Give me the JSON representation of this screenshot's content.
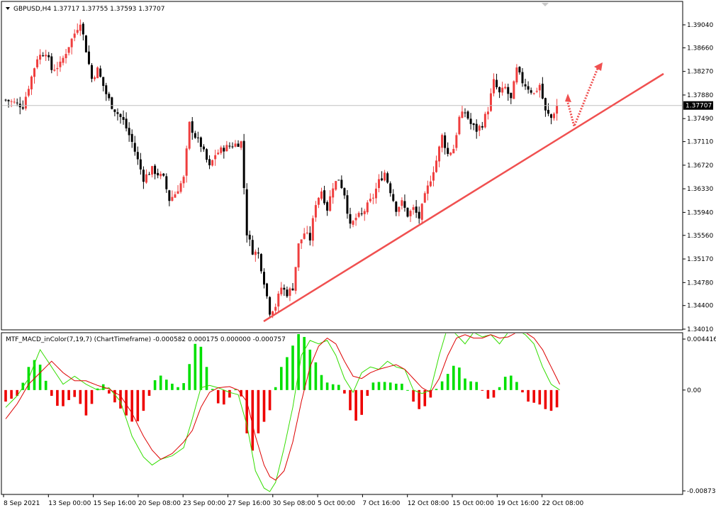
{
  "chart_data": [
    {
      "type": "candlestick",
      "title": "GBPUSD,H4  1.37717 1.37755 1.37593 1.37707",
      "current_price_label": "1.37707",
      "current_price": 1.37707,
      "ylim": [
        1.3401,
        1.3942
      ],
      "y_ticks": [
        "1.39040",
        "1.38660",
        "1.38270",
        "1.37880",
        "1.37490",
        "1.37110",
        "1.36720",
        "1.36330",
        "1.35940",
        "1.35560",
        "1.35170",
        "1.34780",
        "1.34400",
        "1.34010"
      ],
      "x_ticks": [
        "8 Sep 2021",
        "13 Sep 00:00",
        "15 Sep 16:00",
        "20 Sep 08:00",
        "23 Sep 00:00",
        "27 Sep 16:00",
        "30 Sep 08:00",
        "5 Oct 00:00",
        "7 Oct 16:00",
        "12 Oct 08:00",
        "15 Oct 00:00",
        "19 Oct 16:00",
        "22 Oct 08:00"
      ],
      "close_path": [
        [
          0,
          1.378
        ],
        [
          6,
          1.377
        ],
        [
          11,
          1.385
        ],
        [
          14,
          1.386
        ],
        [
          16,
          1.383
        ],
        [
          19,
          1.3838
        ],
        [
          22,
          1.387
        ],
        [
          26,
          1.391
        ],
        [
          30,
          1.3815
        ],
        [
          32,
          1.383
        ],
        [
          35,
          1.379
        ],
        [
          37,
          1.377
        ],
        [
          41,
          1.3745
        ],
        [
          44,
          1.371
        ],
        [
          48,
          1.365
        ],
        [
          51,
          1.3665
        ],
        [
          55,
          1.365
        ],
        [
          57,
          1.3615
        ],
        [
          59,
          1.3625
        ],
        [
          62,
          1.365
        ],
        [
          64,
          1.374
        ],
        [
          66,
          1.372
        ],
        [
          68,
          1.3705
        ],
        [
          71,
          1.3668
        ],
        [
          73,
          1.369
        ],
        [
          76,
          1.37
        ],
        [
          79,
          1.3705
        ],
        [
          82,
          1.371
        ],
        [
          84,
          1.356
        ],
        [
          86,
          1.353
        ],
        [
          88,
          1.3525
        ],
        [
          90,
          1.348
        ],
        [
          92,
          1.343
        ],
        [
          94,
          1.344
        ],
        [
          96,
          1.347
        ],
        [
          98,
          1.346
        ],
        [
          100,
          1.347
        ],
        [
          102,
          1.354
        ],
        [
          104,
          1.356
        ],
        [
          106,
          1.355
        ],
        [
          108,
          1.361
        ],
        [
          110,
          1.363
        ],
        [
          112,
          1.36
        ],
        [
          114,
          1.3638
        ],
        [
          116,
          1.365
        ],
        [
          118,
          1.3625
        ],
        [
          120,
          1.357
        ],
        [
          122,
          1.3585
        ],
        [
          124,
          1.359
        ],
        [
          126,
          1.3605
        ],
        [
          128,
          1.362
        ],
        [
          130,
          1.3645
        ],
        [
          132,
          1.366
        ],
        [
          134,
          1.363
        ],
        [
          136,
          1.36
        ],
        [
          138,
          1.361
        ],
        [
          140,
          1.359
        ],
        [
          142,
          1.36
        ],
        [
          144,
          1.3585
        ],
        [
          146,
          1.362
        ],
        [
          148,
          1.365
        ],
        [
          150,
          1.368
        ],
        [
          152,
          1.372
        ],
        [
          154,
          1.369
        ],
        [
          156,
          1.37
        ],
        [
          158,
          1.375
        ],
        [
          160,
          1.376
        ],
        [
          162,
          1.374
        ],
        [
          164,
          1.373
        ],
        [
          166,
          1.374
        ],
        [
          168,
          1.3765
        ],
        [
          170,
          1.381
        ],
        [
          172,
          1.379
        ],
        [
          174,
          1.38
        ],
        [
          176,
          1.378
        ],
        [
          178,
          1.383
        ],
        [
          180,
          1.381
        ],
        [
          182,
          1.38
        ],
        [
          184,
          1.379
        ],
        [
          186,
          1.3805
        ],
        [
          188,
          1.376
        ],
        [
          190,
          1.375
        ],
        [
          192,
          1.3771
        ]
      ],
      "annotations": [
        "rising-trendline",
        "projected-path-arrow"
      ]
    },
    {
      "type": "bar+line",
      "title": "MTF_MACD_inColor(7,19,7) (ChartTimeframe) -0.000582 0.000175 0.000000 -0.000757",
      "ylim": [
        -0.008737,
        0.004416
      ],
      "y_ticks": [
        "0.004416",
        "0.00",
        "-0.008737"
      ],
      "histogram_path": [
        [
          0,
          -0.001
        ],
        [
          4,
          -0.0005
        ],
        [
          7,
          0.0012
        ],
        [
          9,
          0.0028
        ],
        [
          12,
          0.0022
        ],
        [
          14,
          0.0008
        ],
        [
          16,
          -0.0005
        ],
        [
          19,
          -0.0018
        ],
        [
          21,
          -0.001
        ],
        [
          24,
          -0.0006
        ],
        [
          26,
          -0.0012
        ],
        [
          28,
          -0.0022
        ],
        [
          30,
          -0.0012
        ],
        [
          33,
          0.0008
        ],
        [
          35,
          0.0002
        ],
        [
          37,
          -0.0008
        ],
        [
          40,
          -0.0016
        ],
        [
          42,
          -0.0022
        ],
        [
          45,
          -0.003
        ],
        [
          47,
          -0.0024
        ],
        [
          49,
          -0.0012
        ],
        [
          51,
          0.0002
        ],
        [
          53,
          0.0015
        ],
        [
          55,
          0.001
        ],
        [
          57,
          0.0008
        ],
        [
          59,
          0.0003
        ],
        [
          61,
          0.0002
        ],
        [
          63,
          0.001
        ],
        [
          65,
          0.0035
        ],
        [
          67,
          0.0045
        ],
        [
          69,
          0.003
        ],
        [
          71,
          0.001
        ],
        [
          73,
          -0.0008
        ],
        [
          75,
          -0.0015
        ],
        [
          77,
          -0.001
        ],
        [
          79,
          -0.0003
        ],
        [
          81,
          0.0004
        ],
        [
          83,
          -0.0015
        ],
        [
          85,
          -0.006
        ],
        [
          87,
          -0.0045
        ],
        [
          89,
          -0.003
        ],
        [
          91,
          -0.0025
        ],
        [
          93,
          -0.001
        ],
        [
          95,
          0.0015
        ],
        [
          97,
          0.0025
        ],
        [
          99,
          0.0032
        ],
        [
          101,
          0.0045
        ],
        [
          103,
          0.0052
        ],
        [
          105,
          0.004
        ],
        [
          107,
          0.003
        ],
        [
          109,
          0.0018
        ],
        [
          111,
          0.0008
        ],
        [
          113,
          0.0005
        ],
        [
          115,
          0.0005
        ],
        [
          117,
          0.0004
        ],
        [
          119,
          -0.001
        ],
        [
          121,
          -0.0025
        ],
        [
          123,
          -0.0028
        ],
        [
          125,
          -0.0015
        ],
        [
          127,
          0.0005
        ],
        [
          129,
          0.0008
        ],
        [
          131,
          0.0006
        ],
        [
          133,
          0.0008
        ],
        [
          135,
          0.0005
        ],
        [
          137,
          0.0006
        ],
        [
          139,
          0.0005
        ],
        [
          141,
          -0.0005
        ],
        [
          143,
          -0.0015
        ],
        [
          145,
          -0.0018
        ],
        [
          147,
          -0.001
        ],
        [
          149,
          -0.0003
        ],
        [
          151,
          0.0005
        ],
        [
          153,
          0.001
        ],
        [
          155,
          0.0018
        ],
        [
          157,
          0.0024
        ],
        [
          159,
          0.0015
        ],
        [
          161,
          0.0005
        ],
        [
          163,
          0.001
        ],
        [
          165,
          0.0004
        ],
        [
          167,
          -0.0005
        ],
        [
          169,
          -0.001
        ],
        [
          171,
          -0.0003
        ],
        [
          173,
          0.0008
        ],
        [
          175,
          0.0015
        ],
        [
          177,
          0.001
        ],
        [
          179,
          0.0004
        ],
        [
          181,
          -0.0008
        ],
        [
          183,
          -0.0012
        ],
        [
          185,
          -0.001
        ],
        [
          187,
          -0.0015
        ],
        [
          189,
          -0.0018
        ],
        [
          191,
          -0.0018
        ],
        [
          193,
          -0.0012
        ]
      ],
      "green_line": [
        [
          0,
          -0.0015
        ],
        [
          4,
          -0.0005
        ],
        [
          8,
          0.001
        ],
        [
          12,
          0.0035
        ],
        [
          16,
          0.002
        ],
        [
          20,
          0.0005
        ],
        [
          24,
          0.0012
        ],
        [
          28,
          0.0005
        ],
        [
          32,
          0.0
        ],
        [
          36,
          0.0002
        ],
        [
          40,
          -0.001
        ],
        [
          44,
          -0.004
        ],
        [
          48,
          -0.0058
        ],
        [
          51,
          -0.0065
        ],
        [
          54,
          -0.006
        ],
        [
          58,
          -0.0057
        ],
        [
          62,
          -0.005
        ],
        [
          65,
          -0.0025
        ],
        [
          68,
          0.0002
        ],
        [
          71,
          0.0004
        ],
        [
          74,
          0.0002
        ],
        [
          78,
          -0.0002
        ],
        [
          81,
          -0.0004
        ],
        [
          84,
          -0.003
        ],
        [
          87,
          -0.007
        ],
        [
          90,
          -0.0085
        ],
        [
          92,
          -0.0088
        ],
        [
          94,
          -0.008
        ],
        [
          97,
          -0.005
        ],
        [
          100,
          -0.0015
        ],
        [
          103,
          0.003
        ],
        [
          106,
          0.0043
        ],
        [
          109,
          0.004
        ],
        [
          112,
          0.0043
        ],
        [
          115,
          0.003
        ],
        [
          118,
          0.001
        ],
        [
          121,
          -0.0002
        ],
        [
          124,
          0.0015
        ],
        [
          127,
          0.002
        ],
        [
          130,
          0.0018
        ],
        [
          133,
          0.0025
        ],
        [
          136,
          0.002
        ],
        [
          139,
          0.0018
        ],
        [
          142,
          0.0
        ],
        [
          145,
          -0.0003
        ],
        [
          148,
          0.0
        ],
        [
          151,
          0.003
        ],
        [
          154,
          0.0055
        ],
        [
          157,
          0.0048
        ],
        [
          160,
          0.004
        ],
        [
          163,
          0.005
        ],
        [
          166,
          0.0046
        ],
        [
          169,
          0.0048
        ],
        [
          172,
          0.004
        ],
        [
          175,
          0.005
        ],
        [
          178,
          0.0052
        ],
        [
          181,
          0.0048
        ],
        [
          184,
          0.004
        ],
        [
          187,
          0.002
        ],
        [
          190,
          0.0005
        ],
        [
          193,
          0.0
        ]
      ],
      "red_line": [
        [
          0,
          -0.0025
        ],
        [
          4,
          -0.0012
        ],
        [
          8,
          0.0005
        ],
        [
          12,
          0.0015
        ],
        [
          16,
          0.0025
        ],
        [
          20,
          0.0015
        ],
        [
          24,
          0.0008
        ],
        [
          28,
          0.0008
        ],
        [
          32,
          0.0004
        ],
        [
          36,
          0.0001
        ],
        [
          40,
          -0.0005
        ],
        [
          44,
          -0.002
        ],
        [
          48,
          -0.004
        ],
        [
          51,
          -0.0052
        ],
        [
          54,
          -0.006
        ],
        [
          58,
          -0.0055
        ],
        [
          62,
          -0.0045
        ],
        [
          65,
          -0.0035
        ],
        [
          68,
          -0.0015
        ],
        [
          71,
          -0.0002
        ],
        [
          74,
          0.0002
        ],
        [
          78,
          0.0003
        ],
        [
          81,
          0.0
        ],
        [
          84,
          -0.001
        ],
        [
          87,
          -0.004
        ],
        [
          90,
          -0.0065
        ],
        [
          92,
          -0.0075
        ],
        [
          94,
          -0.0078
        ],
        [
          97,
          -0.007
        ],
        [
          100,
          -0.0045
        ],
        [
          103,
          -0.001
        ],
        [
          106,
          0.002
        ],
        [
          109,
          0.0038
        ],
        [
          112,
          0.0045
        ],
        [
          115,
          0.004
        ],
        [
          118,
          0.0025
        ],
        [
          121,
          0.0012
        ],
        [
          124,
          0.001
        ],
        [
          127,
          0.0015
        ],
        [
          130,
          0.0018
        ],
        [
          133,
          0.002
        ],
        [
          136,
          0.0022
        ],
        [
          139,
          0.0018
        ],
        [
          142,
          0.001
        ],
        [
          145,
          0.0002
        ],
        [
          148,
          -0.0002
        ],
        [
          151,
          0.001
        ],
        [
          154,
          0.003
        ],
        [
          157,
          0.0045
        ],
        [
          160,
          0.0048
        ],
        [
          163,
          0.0045
        ],
        [
          166,
          0.0045
        ],
        [
          169,
          0.0048
        ],
        [
          172,
          0.0045
        ],
        [
          175,
          0.0046
        ],
        [
          178,
          0.005
        ],
        [
          181,
          0.005
        ],
        [
          184,
          0.0045
        ],
        [
          187,
          0.0035
        ],
        [
          190,
          0.002
        ],
        [
          193,
          0.0005
        ]
      ]
    }
  ],
  "colors": {
    "bull": "#ef3e3e",
    "bear": "#000000",
    "hist_up": "#00e000",
    "hist_down": "#ee0000",
    "macd": "#33dd00",
    "signal": "#dd0000",
    "trendline": "#f05050",
    "arrow": "#f05050",
    "grid": "#c0c0c0",
    "price_tag_bg": "#000000",
    "price_tag_fg": "#ffffff"
  }
}
